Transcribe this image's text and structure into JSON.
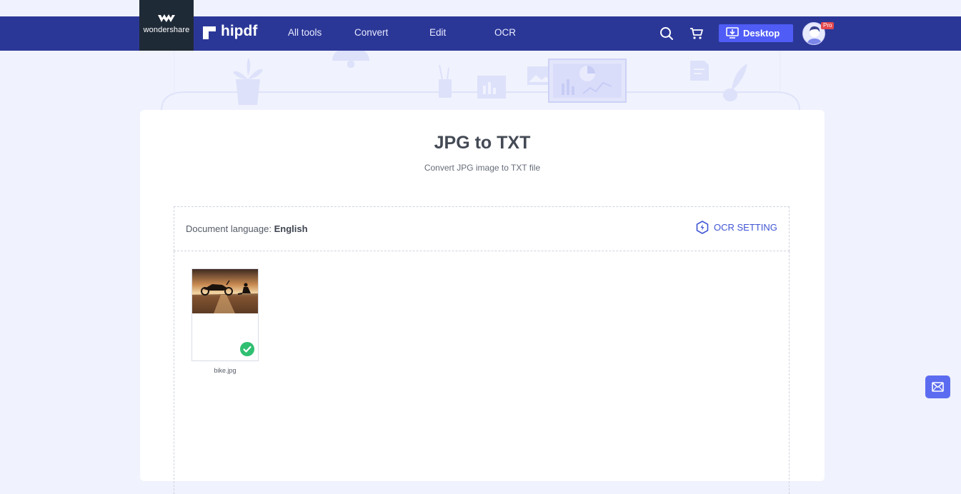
{
  "brand": {
    "company": "wondershare",
    "product": "hipdf"
  },
  "nav": {
    "links": [
      "All tools",
      "Convert",
      "Edit",
      "OCR"
    ],
    "desktop_label": "Desktop",
    "pro_badge": "Pro",
    "icons": [
      "search-icon",
      "cart-icon",
      "download-desktop-icon",
      "avatar"
    ]
  },
  "page": {
    "title": "JPG to TXT",
    "subtitle": "Convert JPG image to TXT file"
  },
  "language_bar": {
    "label": "Document language:",
    "value": "English",
    "ocr_setting_label": "OCR SETTING"
  },
  "files": [
    {
      "name": "bike.jpg",
      "status": "done"
    }
  ],
  "colors": {
    "nav_bg": "#2b3797",
    "brand_bg": "#1f2a37",
    "accent": "#4f5cf6",
    "ocr_link": "#3e55d4",
    "success": "#2fbf71",
    "page_bg": "#f0f2fd"
  }
}
